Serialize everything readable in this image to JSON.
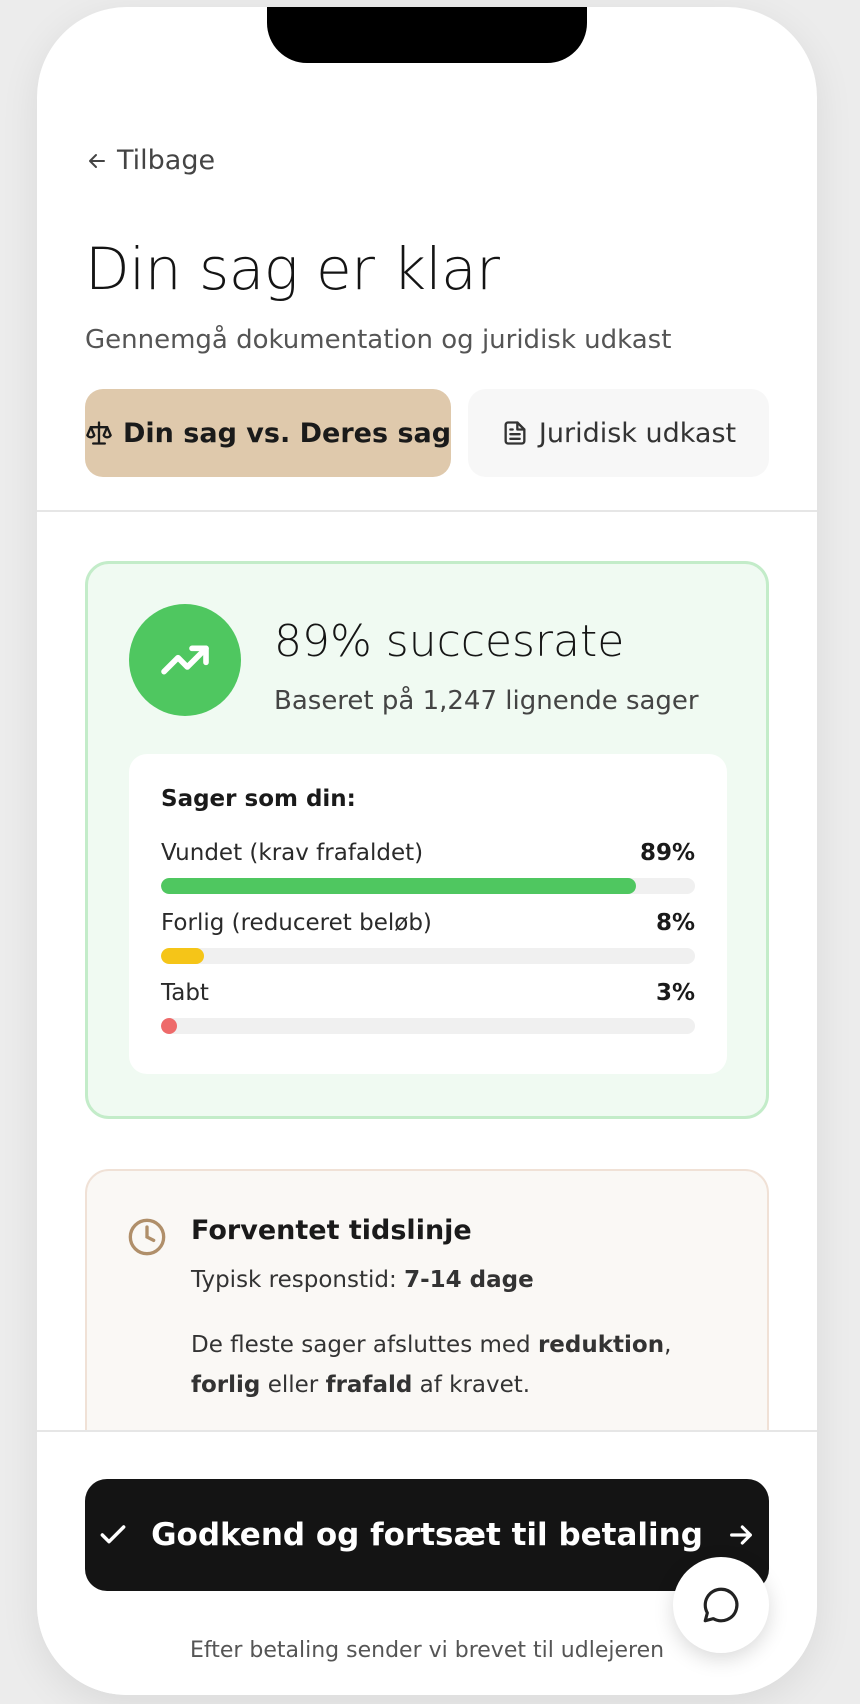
{
  "nav": {
    "back_label": "Tilbage"
  },
  "header": {
    "title": "Din sag er klar",
    "subtitle": "Gennemgå dokumentation og juridisk udkast"
  },
  "tabs": [
    {
      "label": "Din sag vs. Deres sag",
      "icon": "scale-icon",
      "active": true
    },
    {
      "label": "Juridisk udkast",
      "icon": "document-icon",
      "active": false
    }
  ],
  "success": {
    "title": "89% succesrate",
    "subtitle": "Baseret på 1,247 lignende sager",
    "icon": "trending-up-icon",
    "color": "#4fc760"
  },
  "stats": {
    "heading": "Sager som din:",
    "items": [
      {
        "label": "Vundet (krav frafaldet)",
        "pct_label": "89%",
        "value": 89,
        "color": "#4fc760"
      },
      {
        "label": "Forlig (reduceret beløb)",
        "pct_label": "8%",
        "value": 8,
        "color": "#f5c518"
      },
      {
        "label": "Tabt",
        "pct_label": "3%",
        "value": 3,
        "color": "#ee6a6a"
      }
    ]
  },
  "timeline": {
    "icon": "clock-icon",
    "title": "Forventet tidslinje",
    "response_prefix": "Typisk responstid: ",
    "response_value": "7-14 dage",
    "body_1": "De fleste sager afsluttes med ",
    "body_b1": "reduktion",
    "body_2": ", ",
    "body_b2": "forlig",
    "body_3": " eller ",
    "body_b3": "frafald",
    "body_4": " af kravet."
  },
  "footer": {
    "cta_label": "Godkend og fortsæt til betaling",
    "note": "Efter betaling sender vi brevet til udlejeren"
  },
  "chat": {
    "icon": "chat-bubble-icon"
  }
}
